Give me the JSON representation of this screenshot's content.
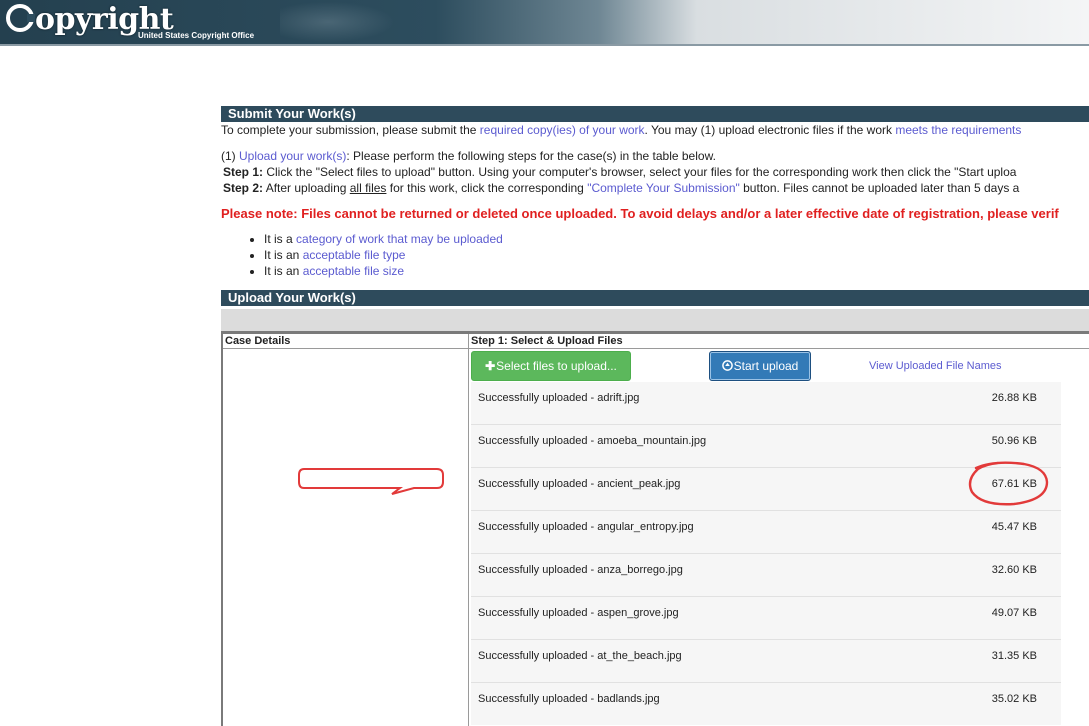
{
  "header": {
    "logo_text": "opyright",
    "logo_subtitle": "United States Copyright Office"
  },
  "submit": {
    "title": "Submit Your Work(s)",
    "intro_prefix": "To complete your submission, please submit the ",
    "intro_link1": "required copy(ies) of your work",
    "intro_middle": ". You may (1) upload electronic files if the work ",
    "intro_link2": "meets the requirements",
    "step_intro_prefix": "(1) ",
    "step_intro_link": "Upload your work(s)",
    "step_intro_suffix": ": Please perform the following steps for the case(s) in the table below.",
    "step1_label": "Step 1:",
    "step1_text": " Click the \"Select files to upload\" button. Using your computer's browser, select your files for the corresponding work then click the \"Start uploa",
    "step2_label": "Step 2:",
    "step2_prefix": " After uploading ",
    "step2_underline": "all files",
    "step2_middle": " for this work, click the corresponding ",
    "step2_link": "\"Complete Your Submission\"",
    "step2_suffix": " button. Files cannot be uploaded later than 5 days a",
    "note": "Please note: Files cannot be returned or deleted once uploaded. To avoid delays and/or a later effective date of registration, please verif",
    "requirements": [
      {
        "prefix": "It is a ",
        "link": "category of work that may be uploaded"
      },
      {
        "prefix": "It is an ",
        "link": "acceptable file type"
      },
      {
        "prefix": "It is an ",
        "link": "acceptable file size"
      }
    ]
  },
  "upload": {
    "title": "Upload Your Work(s)",
    "col_case": "Case Details",
    "col_step": "Step 1: Select & Upload Files",
    "select_button": "Select files to upload...",
    "start_button": "Start upload",
    "view_link": "View Uploaded File Names",
    "files": [
      {
        "message": "Successfully uploaded - adrift.jpg",
        "size": "26.88 KB"
      },
      {
        "message": "Successfully uploaded - amoeba_mountain.jpg",
        "size": "50.96 KB"
      },
      {
        "message": "Successfully uploaded - ancient_peak.jpg",
        "size": "67.61 KB"
      },
      {
        "message": "Successfully uploaded - angular_entropy.jpg",
        "size": "45.47 KB"
      },
      {
        "message": "Successfully uploaded - anza_borrego.jpg",
        "size": "32.60 KB"
      },
      {
        "message": "Successfully uploaded - aspen_grove.jpg",
        "size": "49.07 KB"
      },
      {
        "message": "Successfully uploaded - at_the_beach.jpg",
        "size": "31.35 KB"
      },
      {
        "message": "Successfully uploaded - badlands.jpg",
        "size": "35.02 KB"
      }
    ]
  },
  "colors": {
    "header_dark": "#24404f",
    "section_bar": "#2e4b5c",
    "link": "#5b5bd0",
    "note_red": "#e02020",
    "select_green": "#5cb85c",
    "start_blue": "#337ab7",
    "annotation_red": "#e23a3a"
  },
  "icons": {
    "select_button": "plus-icon",
    "start_button": "upload-circle-icon"
  }
}
